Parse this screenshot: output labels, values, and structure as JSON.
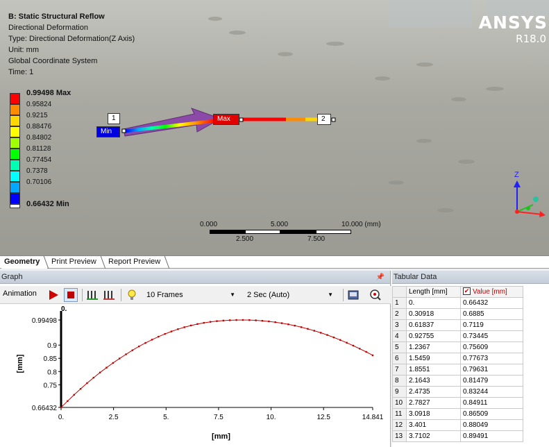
{
  "viewport": {
    "info": {
      "title": "B: Static Structural Reflow",
      "result": "Directional Deformation",
      "type": "Type: Directional Deformation(Z Axis)",
      "unit": "Unit: mm",
      "coords": "Global Coordinate System",
      "time": "Time: 1"
    },
    "logo": {
      "word": "ANSYS",
      "version": "R18.0"
    },
    "legend": {
      "max_label": "0.99498 Max",
      "min_label": "0.66432 Min",
      "values": [
        "0.95824",
        "0.9215",
        "0.88476",
        "0.84802",
        "0.81128",
        "0.77454",
        "0.7378",
        "0.70106"
      ],
      "colors": [
        "#ff0000",
        "#ff8c00",
        "#ffd700",
        "#ffff00",
        "#a0ff00",
        "#00ff00",
        "#00ffb0",
        "#00ffff",
        "#00a8ff",
        "#0000ff"
      ]
    },
    "probes": {
      "p1": "1",
      "p2": "2",
      "max": "Max",
      "min": "Min"
    },
    "triad": {
      "z": "Z"
    },
    "scalebar": {
      "top": [
        "0.000",
        "5.000",
        "10.000 (mm)"
      ],
      "bottom": [
        "2.500",
        "7.500"
      ]
    }
  },
  "tabs": [
    "Geometry",
    "Print Preview",
    "Report Preview"
  ],
  "graph": {
    "header": "Graph",
    "toolbar": {
      "animation_label": "Animation",
      "frames": "10 Frames",
      "duration": "2 Sec (Auto)"
    },
    "top_time_label": "0."
  },
  "chart_data": {
    "type": "line",
    "xlabel": "[mm]",
    "ylabel": "[mm]",
    "xlim": [
      0,
      14.841
    ],
    "ylim": [
      0.66432,
      0.99498
    ],
    "x_ticks": [
      "0.",
      "2.5",
      "5.",
      "7.5",
      "10.",
      "12.5",
      "14.841"
    ],
    "y_ticks": [
      "0.66432",
      "0.75",
      "0.8",
      "0.85",
      "0.9",
      "0.99498"
    ],
    "series": [
      {
        "x": [
          0,
          0.30918,
          0.61837,
          0.92755,
          1.2367,
          1.5459,
          1.8551,
          2.1643,
          2.4735,
          2.7827,
          3.0918,
          3.401,
          3.7102,
          4.0194,
          4.3286,
          4.6378,
          4.947,
          5.2561,
          5.5653,
          5.8745,
          6.1837,
          6.4929,
          6.8021,
          7.1112,
          7.4204,
          7.7296,
          8.0388,
          8.348,
          8.6572,
          8.9664,
          9.2755,
          9.5847,
          9.8939,
          10.203,
          10.512,
          10.822,
          11.131,
          11.44,
          11.749,
          12.058,
          12.368,
          12.677,
          12.986,
          13.295,
          13.604,
          13.914,
          14.223,
          14.532,
          14.841
        ],
        "values": [
          0.66432,
          0.6885,
          0.7119,
          0.73445,
          0.75609,
          0.77673,
          0.79631,
          0.81479,
          0.83244,
          0.84911,
          0.86509,
          0.88049,
          0.89491,
          0.9082,
          0.9205,
          0.9318,
          0.9422,
          0.9516,
          0.9601,
          0.9676,
          0.9741,
          0.9796,
          0.9842,
          0.9879,
          0.9907,
          0.9927,
          0.994,
          0.9948,
          0.99498,
          0.9946,
          0.9936,
          0.9919,
          0.9896,
          0.9866,
          0.9829,
          0.9785,
          0.9735,
          0.9678,
          0.9614,
          0.9543,
          0.9466,
          0.9382,
          0.9291,
          0.9194,
          0.909,
          0.898,
          0.8864,
          0.8742,
          0.8614
        ]
      }
    ]
  },
  "tabular": {
    "header": "Tabular Data",
    "columns": [
      "Length [mm]",
      "Value [mm]"
    ],
    "rows": [
      [
        "1",
        "0.",
        "0.66432"
      ],
      [
        "2",
        "0.30918",
        "0.6885"
      ],
      [
        "3",
        "0.61837",
        "0.7119"
      ],
      [
        "4",
        "0.92755",
        "0.73445"
      ],
      [
        "5",
        "1.2367",
        "0.75609"
      ],
      [
        "6",
        "1.5459",
        "0.77673"
      ],
      [
        "7",
        "1.8551",
        "0.79631"
      ],
      [
        "8",
        "2.1643",
        "0.81479"
      ],
      [
        "9",
        "2.4735",
        "0.83244"
      ],
      [
        "10",
        "2.7827",
        "0.84911"
      ],
      [
        "11",
        "3.0918",
        "0.86509"
      ],
      [
        "12",
        "3.401",
        "0.88049"
      ],
      [
        "13",
        "3.7102",
        "0.89491"
      ]
    ]
  }
}
